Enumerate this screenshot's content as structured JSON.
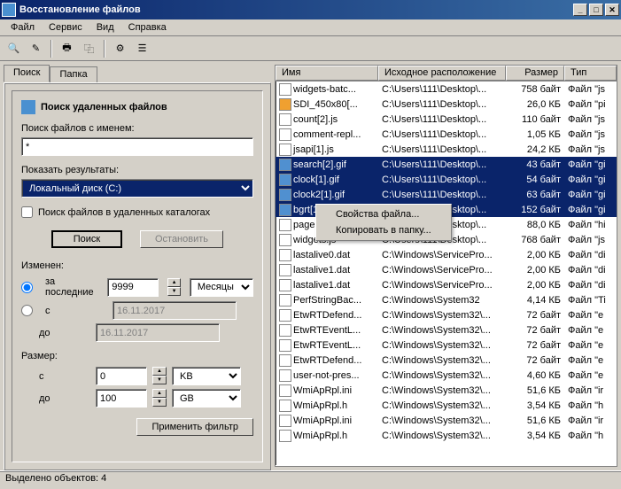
{
  "window": {
    "title": "Восстановление файлов"
  },
  "menu": {
    "file": "Файл",
    "service": "Сервис",
    "view": "Вид",
    "help": "Справка"
  },
  "tabs": {
    "search": "Поиск",
    "folder": "Папка"
  },
  "search_panel": {
    "title": "Поиск удаленных файлов",
    "name_label": "Поиск файлов с именем:",
    "name_value": "*",
    "results_label": "Показать результаты:",
    "drive": "Локальный диск (C:)",
    "deleted_catalogs": "Поиск файлов в удаленных каталогах",
    "search_btn": "Поиск",
    "stop_btn": "Остановить",
    "changed_label": "Изменен:",
    "radio_last": "за последние",
    "radio_from": "с",
    "last_value": "9999",
    "last_unit": "Месяцы",
    "date_from": "16.11.2017",
    "to_label": "до",
    "date_to": "16.11.2017",
    "size_label": "Размер:",
    "size_from_label": "с",
    "size_from": "0",
    "size_from_unit": "KB",
    "size_to_label": "до",
    "size_to": "100",
    "size_to_unit": "GB",
    "apply_filter": "Применить фильтр"
  },
  "columns": {
    "name": "Имя",
    "path": "Исходное расположение",
    "size": "Размер",
    "type": "Тип"
  },
  "context_menu": {
    "props": "Свойства файла...",
    "copy": "Копировать в папку..."
  },
  "files": [
    {
      "icon": "js",
      "name": "widgets-batc...",
      "path": "C:\\Users\\111\\Desktop\\...",
      "size": "758 байт",
      "type": "Файл \"js"
    },
    {
      "icon": "orange",
      "name": "SDI_450x80[...",
      "path": "C:\\Users\\111\\Desktop\\...",
      "size": "26,0 КБ",
      "type": "Файл \"pi"
    },
    {
      "icon": "js",
      "name": "count[2].js",
      "path": "C:\\Users\\111\\Desktop\\...",
      "size": "110 байт",
      "type": "Файл \"js"
    },
    {
      "icon": "js",
      "name": "comment-repl...",
      "path": "C:\\Users\\111\\Desktop\\...",
      "size": "1,05 КБ",
      "type": "Файл \"js"
    },
    {
      "icon": "js",
      "name": "jsapi[1].js",
      "path": "C:\\Users\\111\\Desktop\\...",
      "size": "24,2 КБ",
      "type": "Файл \"js"
    },
    {
      "icon": "gif",
      "name": "search[2].gif",
      "path": "C:\\Users\\111\\Desktop\\...",
      "size": "43 байт",
      "type": "Файл \"gi",
      "sel": true
    },
    {
      "icon": "gif",
      "name": "clock[1].gif",
      "path": "C:\\Users\\111\\Desktop\\...",
      "size": "54 байт",
      "type": "Файл \"gi",
      "sel": true
    },
    {
      "icon": "gif",
      "name": "clock2[1].gif",
      "path": "C:\\Users\\111\\Desktop\\...",
      "size": "63 байт",
      "type": "Файл \"gi",
      "sel": true
    },
    {
      "icon": "gif",
      "name": "bgrt[1].gif",
      "path": "C:\\Users\\111\\Desktop\\...",
      "size": "152 байт",
      "type": "Файл \"gi",
      "sel": true
    },
    {
      "icon": "file",
      "name": "page[3].htm",
      "path": "C:\\Users\\111\\Desktop\\...",
      "size": "88,0 КБ",
      "type": "Файл \"hi"
    },
    {
      "icon": "js",
      "name": "widgets.js",
      "path": "C:\\Users\\111\\Desktop\\...",
      "size": "768 байт",
      "type": "Файл \"js"
    },
    {
      "icon": "file",
      "name": "lastalive0.dat",
      "path": "C:\\Windows\\ServicePro...",
      "size": "2,00 КБ",
      "type": "Файл \"di"
    },
    {
      "icon": "file",
      "name": "lastalive1.dat",
      "path": "C:\\Windows\\ServicePro...",
      "size": "2,00 КБ",
      "type": "Файл \"di"
    },
    {
      "icon": "file",
      "name": "lastalive1.dat",
      "path": "C:\\Windows\\ServicePro...",
      "size": "2,00 КБ",
      "type": "Файл \"di"
    },
    {
      "icon": "file",
      "name": "PerfStringBac...",
      "path": "C:\\Windows\\System32",
      "size": "4,14 КБ",
      "type": "Файл \"Ti"
    },
    {
      "icon": "file",
      "name": "EtwRTDefend...",
      "path": "C:\\Windows\\System32\\...",
      "size": "72 байт",
      "type": "Файл \"e"
    },
    {
      "icon": "file",
      "name": "EtwRTEventL...",
      "path": "C:\\Windows\\System32\\...",
      "size": "72 байт",
      "type": "Файл \"e"
    },
    {
      "icon": "file",
      "name": "EtwRTEventL...",
      "path": "C:\\Windows\\System32\\...",
      "size": "72 байт",
      "type": "Файл \"e"
    },
    {
      "icon": "file",
      "name": "EtwRTDefend...",
      "path": "C:\\Windows\\System32\\...",
      "size": "72 байт",
      "type": "Файл \"e"
    },
    {
      "icon": "file",
      "name": "user-not-pres...",
      "path": "C:\\Windows\\System32\\...",
      "size": "4,60 КБ",
      "type": "Файл \"e"
    },
    {
      "icon": "file",
      "name": "WmiApRpl.ini",
      "path": "C:\\Windows\\System32\\...",
      "size": "51,6 КБ",
      "type": "Файл \"ir"
    },
    {
      "icon": "file",
      "name": "WmiApRpl.h",
      "path": "C:\\Windows\\System32\\...",
      "size": "3,54 КБ",
      "type": "Файл \"h"
    },
    {
      "icon": "file",
      "name": "WmiApRpl.ini",
      "path": "C:\\Windows\\System32\\...",
      "size": "51,6 КБ",
      "type": "Файл \"ir"
    },
    {
      "icon": "file",
      "name": "WmiApRpl.h",
      "path": "C:\\Windows\\System32\\...",
      "size": "3,54 КБ",
      "type": "Файл \"h"
    }
  ],
  "status": "Выделено объектов: 4"
}
